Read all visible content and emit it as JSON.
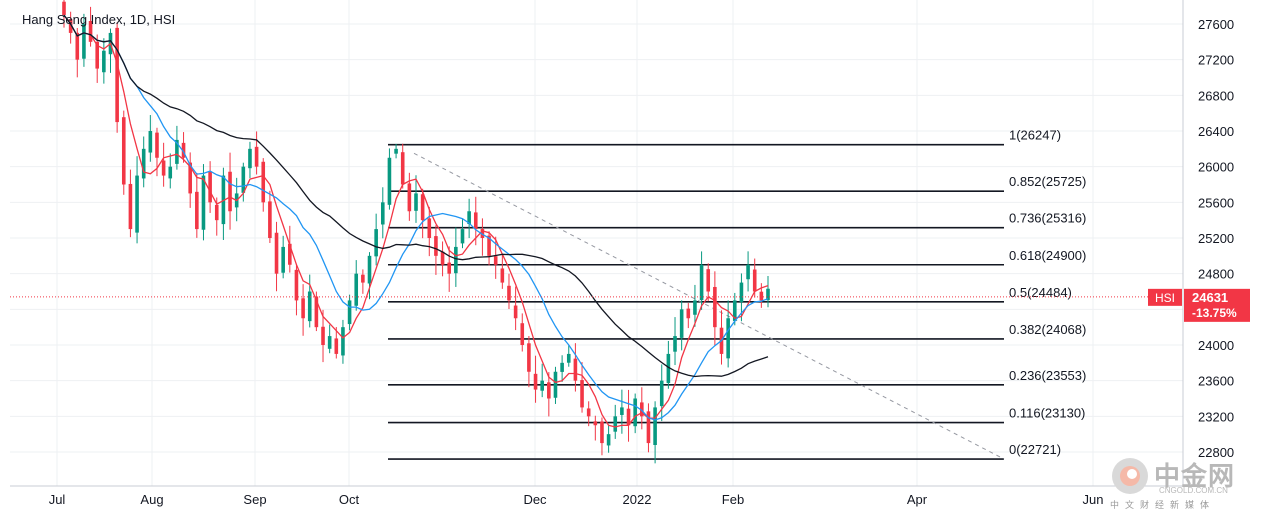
{
  "title": "Hang Seng Index, 1D, HSI",
  "chart_data": {
    "type": "candlestick",
    "symbol": "HSI",
    "interval": "1D",
    "y_range": [
      22600,
      27800
    ],
    "y_ticks": [
      22800,
      23200,
      23600,
      24000,
      24400,
      24800,
      25200,
      25600,
      26000,
      26400,
      26800,
      27200,
      27600
    ],
    "x_ticks": [
      "Jul",
      "Aug",
      "Sep",
      "Oct",
      "Dec",
      "2022",
      "Feb",
      "Apr",
      "Jun"
    ],
    "last_price": {
      "label": "HSI",
      "value": "24631",
      "change": "-13.75%"
    },
    "fibonacci": [
      {
        "label": "1(26247)",
        "value": 26247
      },
      {
        "label": "0.852(25725)",
        "value": 25725
      },
      {
        "label": "0.736(25316)",
        "value": 25316
      },
      {
        "label": "0.618(24900)",
        "value": 24900
      },
      {
        "label": "0.5(24484)",
        "value": 24484
      },
      {
        "label": "0.382(24068)",
        "value": 24068
      },
      {
        "label": "0.236(23553)",
        "value": 23553
      },
      {
        "label": "0.116(23130)",
        "value": 23130
      },
      {
        "label": "0(22721)",
        "value": 22721
      }
    ],
    "closes_approx": [
      27700,
      27500,
      27200,
      27600,
      27400,
      27100,
      27300,
      27500,
      26500,
      25800,
      25300,
      25900,
      26200,
      26400,
      26100,
      25900,
      26000,
      26300,
      26100,
      25700,
      25300,
      25900,
      25600,
      25400,
      25900,
      25500,
      25700,
      26000,
      26200,
      26000,
      25600,
      25200,
      24800,
      25100,
      24900,
      24500,
      24300,
      24600,
      24200,
      24000,
      24100,
      23900,
      24200,
      24500,
      24800,
      24700,
      25000,
      25300,
      25600,
      26100,
      26200,
      25800,
      25500,
      25700,
      25400,
      25200,
      25000,
      24900,
      24800,
      25100,
      25300,
      25500,
      25300,
      25200,
      25000,
      24900,
      24700,
      24500,
      24300,
      24000,
      23700,
      23500,
      23600,
      23400,
      23700,
      23800,
      23900,
      23600,
      23300,
      23200,
      23100,
      22900,
      23000,
      23200,
      23300,
      23100,
      23400,
      23200,
      22900,
      23300,
      23600,
      23900,
      24100,
      24400,
      24300,
      24500,
      24900,
      24600,
      24200,
      23900,
      24300,
      24500,
      24700,
      24900,
      24600,
      24500,
      24631
    ],
    "moving_averages": [
      {
        "color": "#f23645"
      },
      {
        "color": "#2196f3"
      },
      {
        "color": "#131722"
      }
    ],
    "colors": {
      "up": "#089981",
      "down": "#f23645",
      "fib": "#131722",
      "price_line": "#f23645"
    }
  },
  "watermark": {
    "brand": "中金网",
    "domain": "CNGOLD.COM.CN",
    "sub": "中文财经新媒体"
  }
}
